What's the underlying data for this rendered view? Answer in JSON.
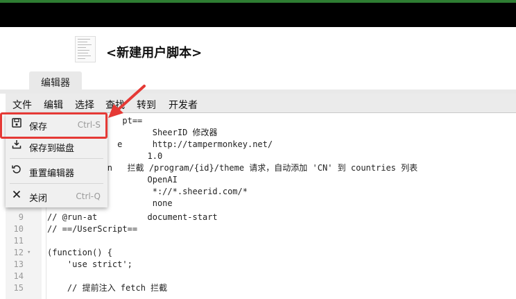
{
  "app": {
    "title": "<新建用户脚本>"
  },
  "tabs": [
    {
      "label": "编辑器"
    }
  ],
  "menubar": {
    "items": [
      "文件",
      "编辑",
      "选择",
      "查找",
      "转到",
      "开发者"
    ]
  },
  "file_menu": {
    "items": [
      {
        "label": "保存",
        "shortcut": "Ctrl-S",
        "icon": "save-icon"
      },
      {
        "label": "保存到磁盘",
        "shortcut": "",
        "icon": "download-icon"
      },
      {
        "label": "重置编辑器",
        "shortcut": "",
        "icon": "reset-icon"
      },
      {
        "label": "关闭",
        "shortcut": "Ctrl-Q",
        "icon": "close-icon"
      }
    ]
  },
  "code": {
    "lines": [
      {
        "num": "",
        "text": "               pt=="
      },
      {
        "num": "",
        "text": "                     SheerID 修改器"
      },
      {
        "num": "",
        "text": "              e      http://tampermonkey.net/"
      },
      {
        "num": "",
        "text": "                    1.0"
      },
      {
        "num": "",
        "text": "          ion   拦截 /program/{id}/theme 请求，自动添加 'CN' 到 countries 列表"
      },
      {
        "num": "",
        "text": "                    OpenAI"
      },
      {
        "num": "",
        "text": "                     *://*.sheerid.com/*"
      },
      {
        "num": "",
        "text": "                     none"
      },
      {
        "num": "9",
        "text": "// @run-at          document-start"
      },
      {
        "num": "10",
        "text": "// ==/UserScript=="
      },
      {
        "num": "11",
        "text": ""
      },
      {
        "num": "12",
        "text": "(function() {"
      },
      {
        "num": "13",
        "text": "    'use strict';"
      },
      {
        "num": "14",
        "text": ""
      },
      {
        "num": "15",
        "text": "    // 提前注入 fetch 拦截"
      }
    ]
  },
  "annotation": {
    "color": "#e53935"
  }
}
